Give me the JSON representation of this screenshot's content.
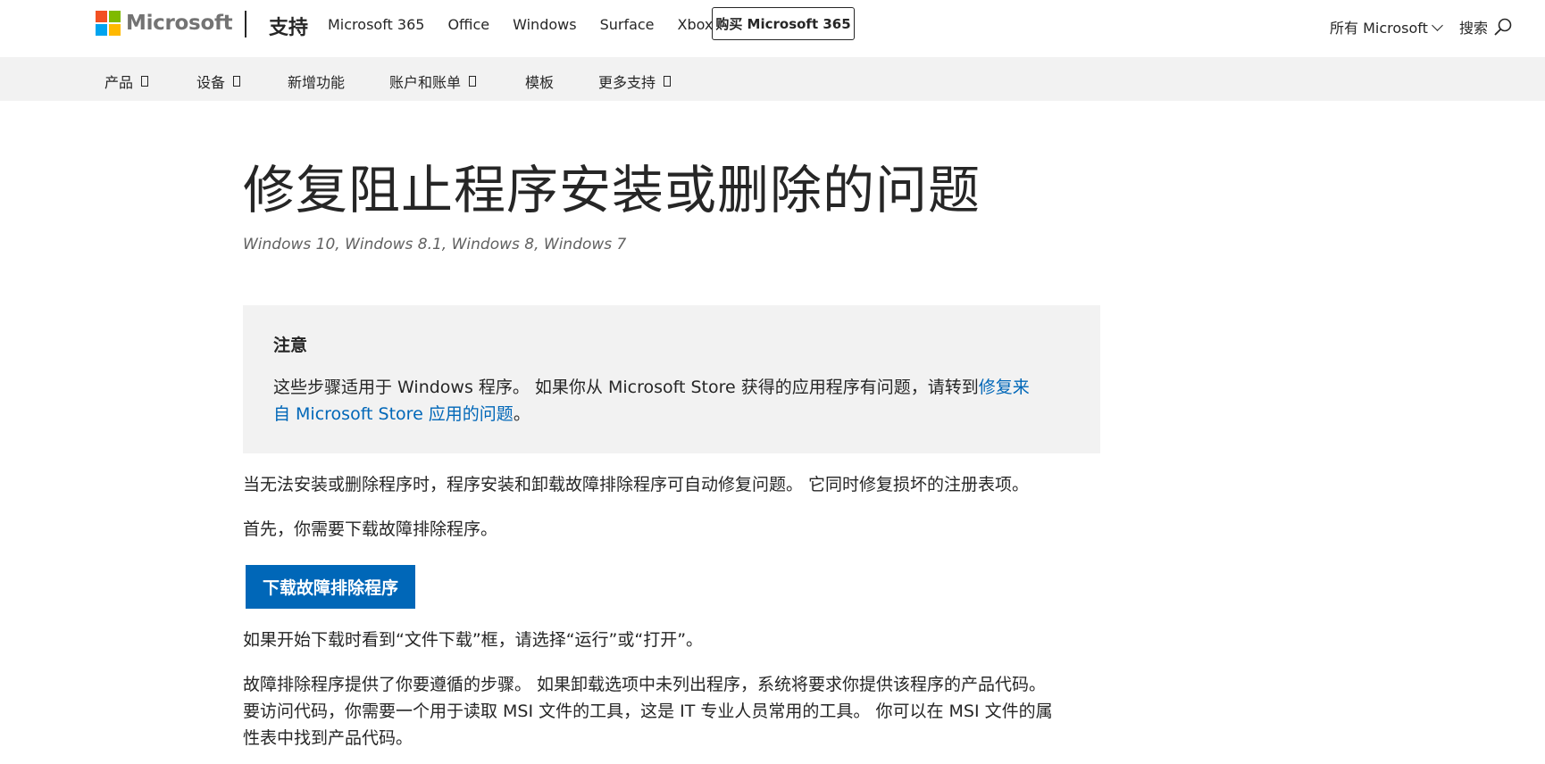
{
  "header": {
    "brand": "Microsoft",
    "logo_colors": [
      "#f25022",
      "#7fba00",
      "#00a4ef",
      "#ffb900"
    ],
    "section_title": "支持",
    "nav_links": [
      "Microsoft 365",
      "Office",
      "Windows",
      "Surface",
      "Xbox"
    ],
    "buy_button": "购买 Microsoft 365",
    "all_microsoft": "所有 Microsoft",
    "search_label": "搜索"
  },
  "subnav": {
    "items": [
      {
        "label": "产品",
        "has_dropdown": true
      },
      {
        "label": "设备",
        "has_dropdown": true
      },
      {
        "label": "新增功能",
        "has_dropdown": false
      },
      {
        "label": "账户和账单",
        "has_dropdown": true
      },
      {
        "label": "模板",
        "has_dropdown": false
      },
      {
        "label": "更多支持",
        "has_dropdown": true
      }
    ]
  },
  "article": {
    "title": "修复阻止程序安装或删除的问题",
    "applies_to": "Windows 10, Windows 8.1, Windows 8, Windows 7",
    "note": {
      "title": "注意",
      "text_before": "这些步骤适用于 Windows 程序。 如果你从 Microsoft Store 获得的应用程序有问题，请转到",
      "link_text": "修复来自 Microsoft Store 应用的问题",
      "text_after": "。"
    },
    "intro": "当无法安装或删除程序时，程序安装和卸载故障排除程序可自动修复问题。 它同时修复损坏的注册表项。",
    "first_step": "首先，你需要下载故障排除程序。",
    "download_button": "下载故障排除程序",
    "download_note": "如果开始下载时看到“文件下载”框，请选择“运行”或“打开”。",
    "detail_lines": [
      "故障排除程序提供了你要遵循的步骤。 如果卸载选项中未列出程序，系统将要求你提供该程序的产品代码。",
      "要访问代码，你需要一个用于读取 MSI 文件的工具，这是 IT 专业人员常用的工具。 你可以在 MSI 文件的属",
      "性表中找到产品代码。"
    ],
    "accent_color": "#0067b8"
  }
}
